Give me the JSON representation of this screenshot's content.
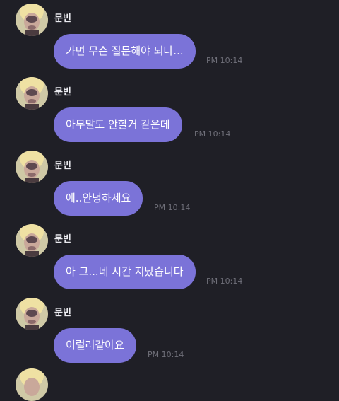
{
  "chat": {
    "messages": [
      {
        "sender": "문빈",
        "text": "가면 무슨 질문해야 되나...",
        "time": "PM 10:14"
      },
      {
        "sender": "문빈",
        "text": "아무말도 안할거 같은데",
        "time": "PM 10:14"
      },
      {
        "sender": "문빈",
        "text": "에..안녕하세요",
        "time": "PM 10:14"
      },
      {
        "sender": "문빈",
        "text": "아 그...네 시간 지났습니다",
        "time": "PM 10:14"
      },
      {
        "sender": "문빈",
        "text": "이럴러같아요",
        "time": "PM 10:14"
      }
    ]
  },
  "colors": {
    "background": "#1f1f26",
    "bubble": "#7b73d8",
    "time_text": "#6f6f79",
    "sender_text": "#e9e9ee"
  },
  "icons": {
    "avatar": "profile-photo"
  }
}
